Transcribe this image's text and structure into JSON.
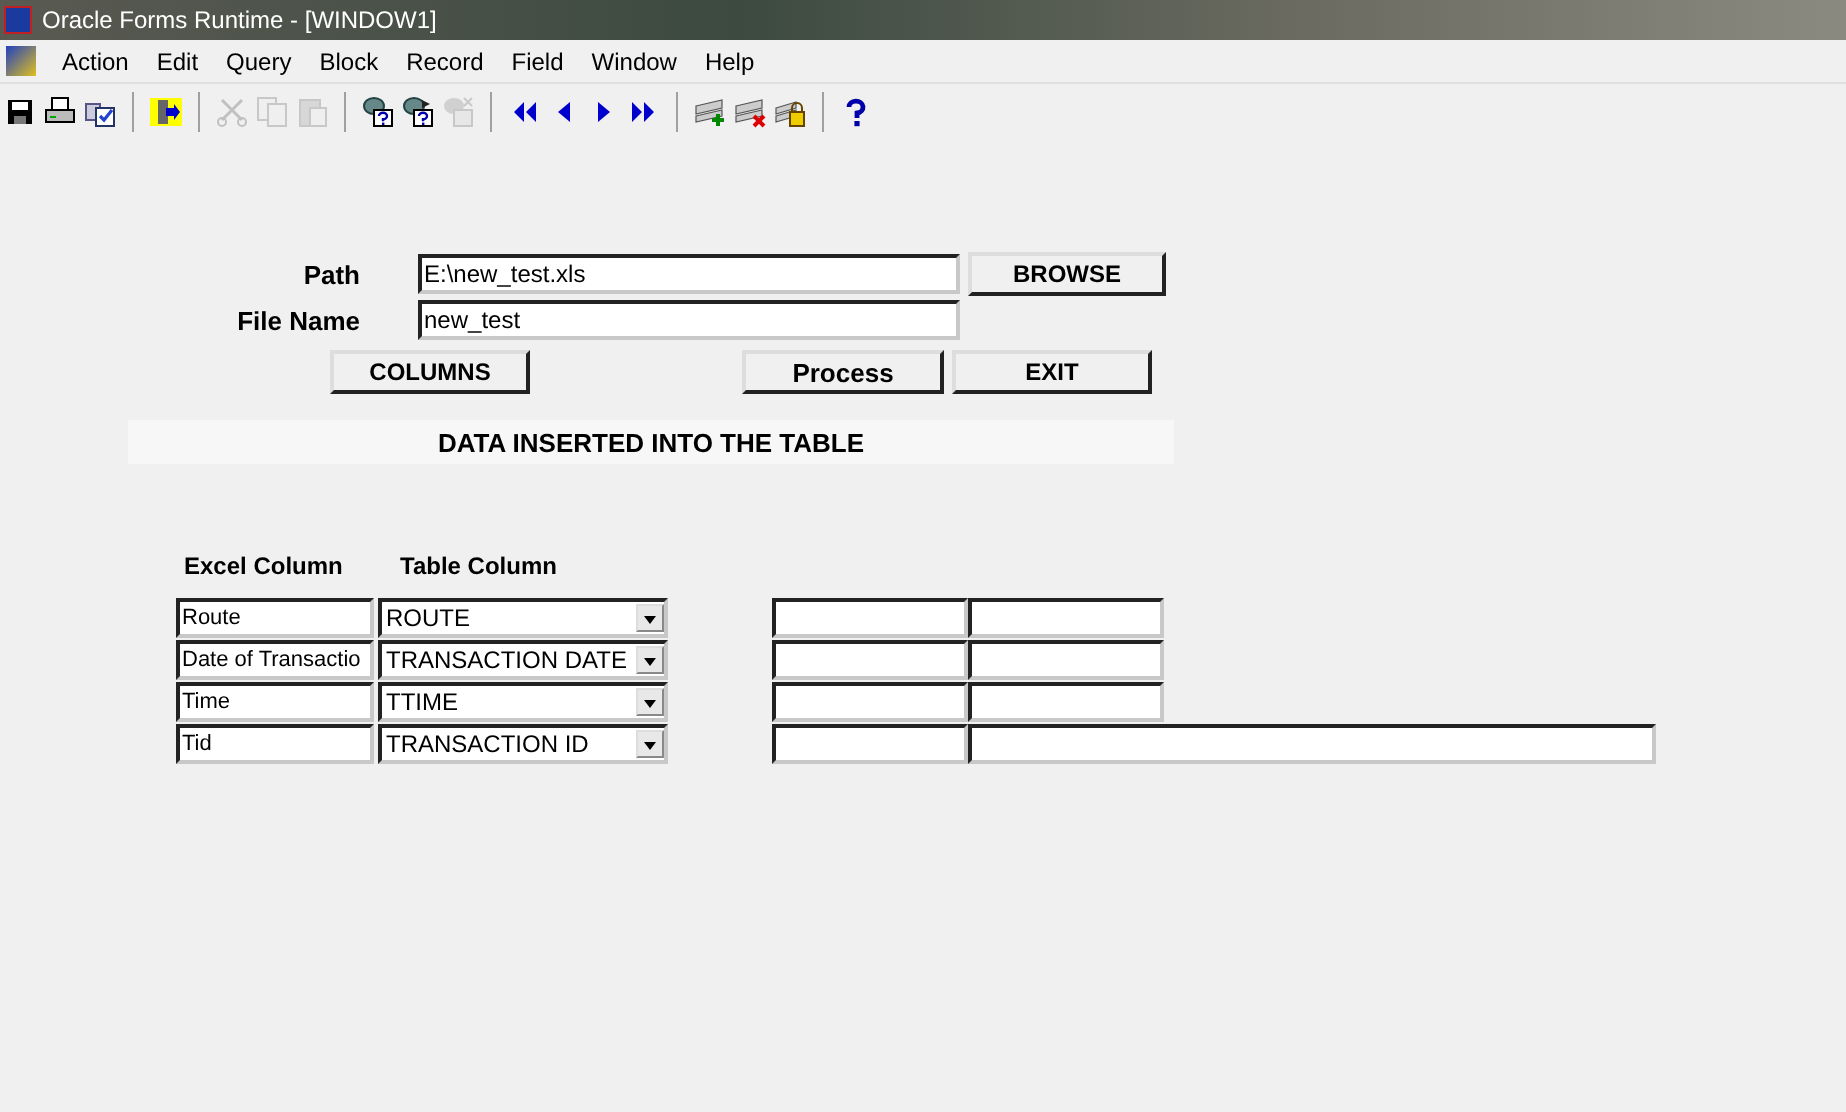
{
  "window": {
    "title": "Oracle Forms Runtime - [WINDOW1]"
  },
  "menu": [
    "Action",
    "Edit",
    "Query",
    "Block",
    "Record",
    "Field",
    "Window",
    "Help"
  ],
  "toolbar": [
    [
      {
        "disabled": false
      },
      {
        "disabled": false
      },
      {
        "disabled": false
      }
    ],
    [
      {
        "disabled": false
      }
    ],
    [
      {
        "disabled": true
      },
      {
        "disabled": true
      },
      {
        "disabled": true
      }
    ],
    [
      {
        "disabled": false
      },
      {
        "disabled": false
      },
      {
        "disabled": true
      }
    ],
    [
      {
        "disabled": false
      },
      {
        "disabled": false
      },
      {
        "disabled": false
      },
      {
        "disabled": false
      }
    ],
    [
      {
        "disabled": false
      },
      {
        "disabled": false
      },
      {
        "disabled": false
      }
    ],
    [
      {
        "disabled": false
      }
    ]
  ],
  "form": {
    "path": {
      "label": "Path",
      "value": "E:\\new_test.xls"
    },
    "browse_button": "BROWSE",
    "file_name": {
      "label": "File Name",
      "value": "new_test"
    },
    "buttons": [
      "COLUMNS",
      "Process",
      "EXIT"
    ],
    "banner": "DATA INSERTED INTO THE TABLE",
    "columns": [
      "Excel Column",
      "Table Column"
    ],
    "rows": [
      {
        "excel": "Route",
        "table_column": "ROUTE",
        "wide": false
      },
      {
        "excel": "Date of Transactio",
        "table_column": "TRANSACTION DATE",
        "wide": false
      },
      {
        "excel": "Time",
        "table_column": "TTIME",
        "wide": false
      },
      {
        "excel": "Tid",
        "table_column": "TRANSACTION ID",
        "wide": true
      }
    ]
  }
}
